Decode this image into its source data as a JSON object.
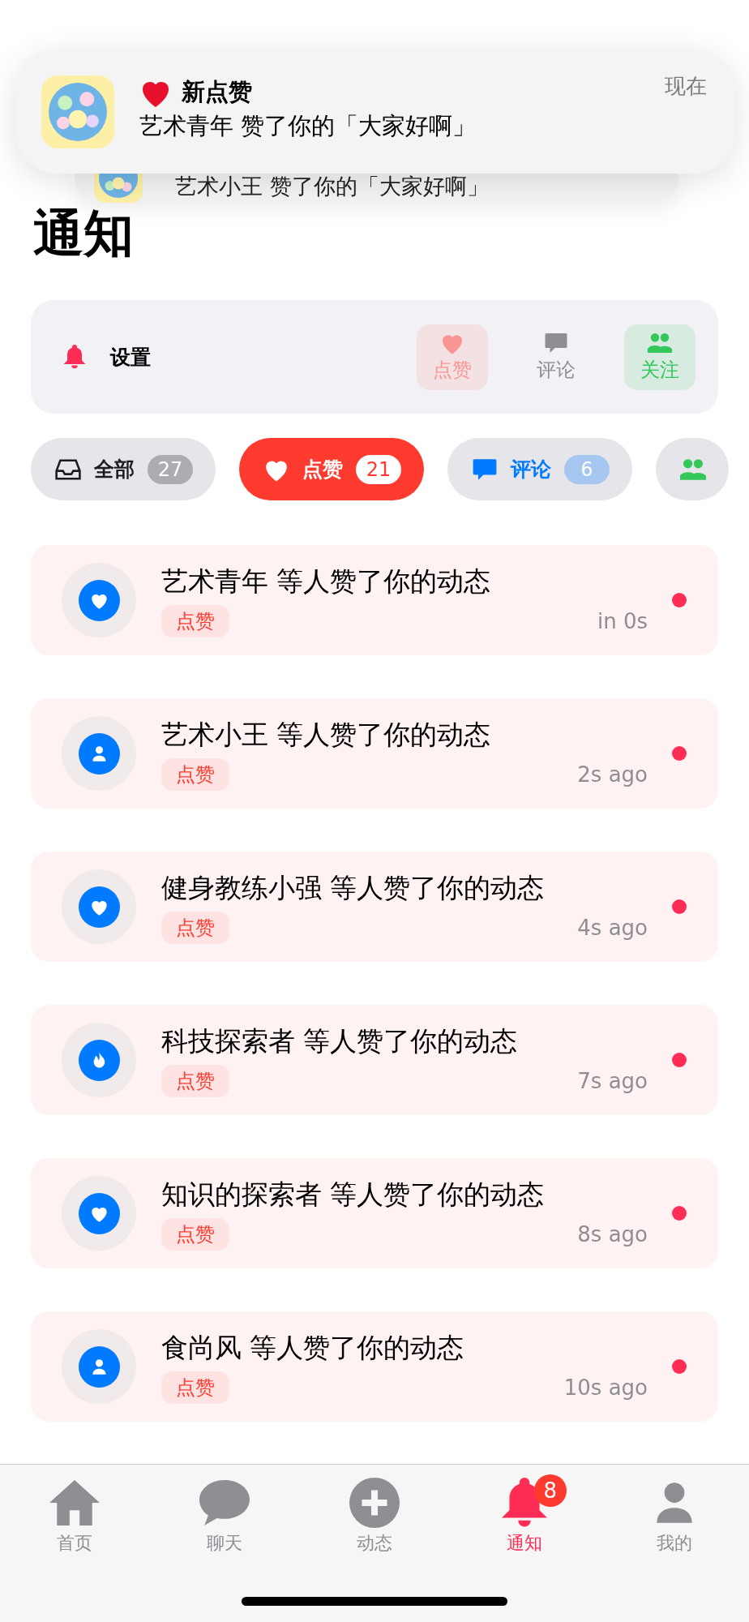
{
  "banner": {
    "title": "新点赞",
    "body": "艺术青年 赞了你的「大家好啊」",
    "time": "现在"
  },
  "stacked_notification": {
    "body": "艺术小王 赞了你的「大家好啊」"
  },
  "title": "通知",
  "settings": {
    "label": "设置",
    "toggles": [
      {
        "label": "点赞",
        "kind": "heart",
        "selected": true,
        "disabled": true
      },
      {
        "label": "评论",
        "kind": "comment",
        "selected": false,
        "disabled": false
      },
      {
        "label": "关注",
        "kind": "people",
        "selected": true,
        "disabled": false
      }
    ]
  },
  "filters": [
    {
      "label": "全部",
      "count": "27",
      "kind": "tray",
      "color": "#1c1c1e",
      "selected": false
    },
    {
      "label": "点赞",
      "count": "21",
      "kind": "heart",
      "color": "#ff3b30",
      "selected": true
    },
    {
      "label": "评论",
      "count": "6",
      "kind": "comment",
      "color": "#007aff",
      "selected": false
    },
    {
      "kind": "people",
      "color": "#34c759",
      "selected": false
    }
  ],
  "notifications": [
    {
      "title": "艺术青年 等人赞了你的动态",
      "tag": "点赞",
      "time": "in 0s",
      "kind": "heart",
      "unread": true
    },
    {
      "title": "艺术小王 等人赞了你的动态",
      "tag": "点赞",
      "time": "2s ago",
      "kind": "person",
      "unread": true
    },
    {
      "title": "健身教练小强 等人赞了你的动态",
      "tag": "点赞",
      "time": "4s ago",
      "kind": "heart",
      "unread": true
    },
    {
      "title": "科技探索者 等人赞了你的动态",
      "tag": "点赞",
      "time": "7s ago",
      "kind": "flame",
      "unread": true
    },
    {
      "title": "知识的探索者 等人赞了你的动态",
      "tag": "点赞",
      "time": "8s ago",
      "kind": "heart",
      "unread": true
    },
    {
      "title": "食尚风 等人赞了你的动态",
      "tag": "点赞",
      "time": "10s ago",
      "kind": "person",
      "unread": true
    }
  ],
  "tab_bar": [
    {
      "label": "首页",
      "kind": "home",
      "selected": false
    },
    {
      "label": "聊天",
      "kind": "chat",
      "selected": false
    },
    {
      "label": "动态",
      "kind": "plus",
      "selected": false
    },
    {
      "label": "通知",
      "kind": "bell",
      "selected": true,
      "badge": "8"
    },
    {
      "label": "我的",
      "kind": "person",
      "selected": false
    }
  ]
}
